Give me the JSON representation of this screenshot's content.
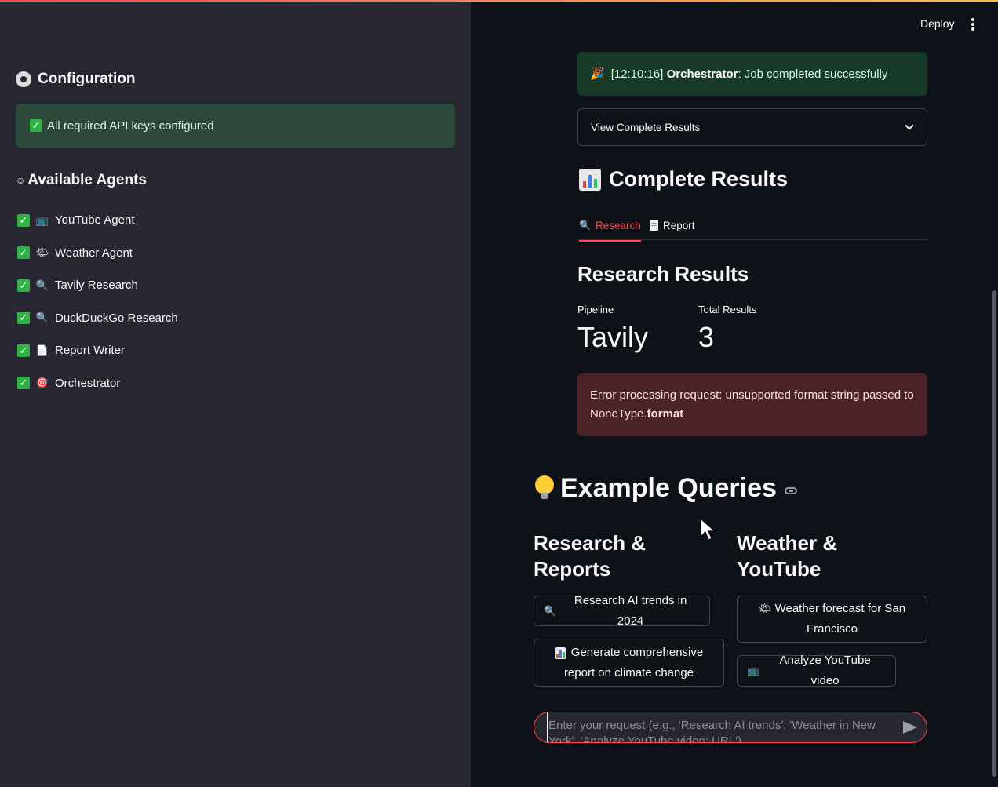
{
  "header": {
    "deploy_label": "Deploy",
    "menu_icon": "kebab-menu-icon"
  },
  "sidebar": {
    "config_heading": "Configuration",
    "config_status": "All required API keys configured",
    "agents_heading": "Available Agents",
    "agents": [
      {
        "icon": "📺",
        "label": "YouTube Agent"
      },
      {
        "icon": "🌤",
        "label": "Weather Agent"
      },
      {
        "icon": "🔍",
        "label": "Tavily Research"
      },
      {
        "icon": "🔍",
        "label": "DuckDuckGo Research"
      },
      {
        "icon": "📄",
        "label": "Report Writer"
      },
      {
        "icon": "🎯",
        "label": "Orchestrator"
      }
    ]
  },
  "main": {
    "status": {
      "icon": "🎉",
      "time": "[12:10:16]",
      "source": "Orchestrator",
      "message": ": Job completed successfully"
    },
    "expander_label": "View Complete Results",
    "results_title": "Complete Results",
    "tabs": [
      {
        "label": "Research",
        "active": true
      },
      {
        "label": "Report",
        "active": false
      }
    ],
    "research_title": "Research Results",
    "metrics": [
      {
        "label": "Pipeline",
        "value": "Tavily"
      },
      {
        "label": "Total Results",
        "value": "3"
      }
    ],
    "error": {
      "text": "Error processing request: unsupported format string passed to NoneType.",
      "bold": "format"
    },
    "examples_title": "Example Queries",
    "research_col": {
      "title": "Research & Reports",
      "buttons": [
        {
          "icon": "🔍",
          "label": "Research AI trends in 2024"
        },
        {
          "icon": "📊",
          "label": "Generate comprehensive report on climate change"
        }
      ]
    },
    "weather_col": {
      "title": "Weather & YouTube",
      "buttons": [
        {
          "icon": "🌤",
          "label": "Weather forecast for San Francisco"
        },
        {
          "icon": "📺",
          "label": "Analyze YouTube video"
        }
      ]
    },
    "chat_placeholder": "Enter your request (e.g., 'Research AI trends', 'Weather in New York', 'Analyze YouTube video: URL')"
  },
  "colors": {
    "accent": "#ff4b4b",
    "success_bg": "#173928",
    "error_bg": "#4a2227",
    "sidebar_bg": "#262730",
    "main_bg": "#0e1117"
  }
}
